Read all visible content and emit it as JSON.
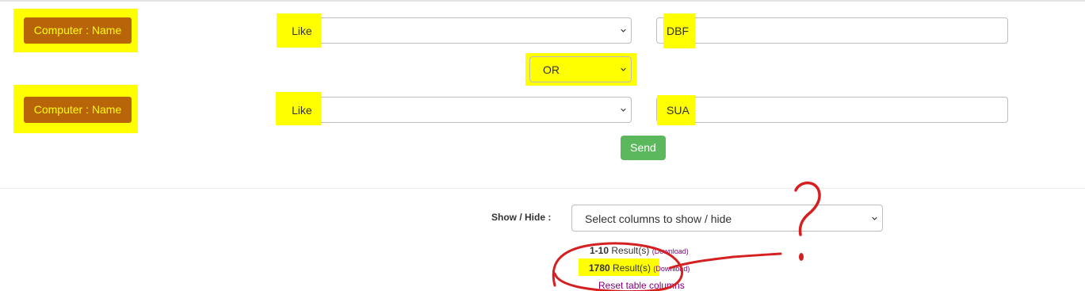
{
  "filters": {
    "row1": {
      "field_label": "Computer : Name",
      "operator": "Like",
      "value": "DBF"
    },
    "combinator": "OR",
    "row2": {
      "field_label": "Computer : Name",
      "operator": "Like",
      "value": "SUA"
    },
    "send_label": "Send"
  },
  "columns": {
    "label": "Show / Hide :",
    "select_placeholder": "Select columns to show / hide"
  },
  "results": {
    "page_range": "1-10",
    "page_suffix": "Result(s)",
    "total": "1780",
    "total_suffix": "Result(s)",
    "download_label": "(Download)",
    "reset_label": "Reset table columns"
  },
  "annotation": {
    "marker_color": "#d42020",
    "highlight_color": "#ffff00",
    "symbol": "?"
  },
  "colors": {
    "field_button": "#b8650a",
    "send_button": "#5cb85c",
    "link": "#800080"
  }
}
